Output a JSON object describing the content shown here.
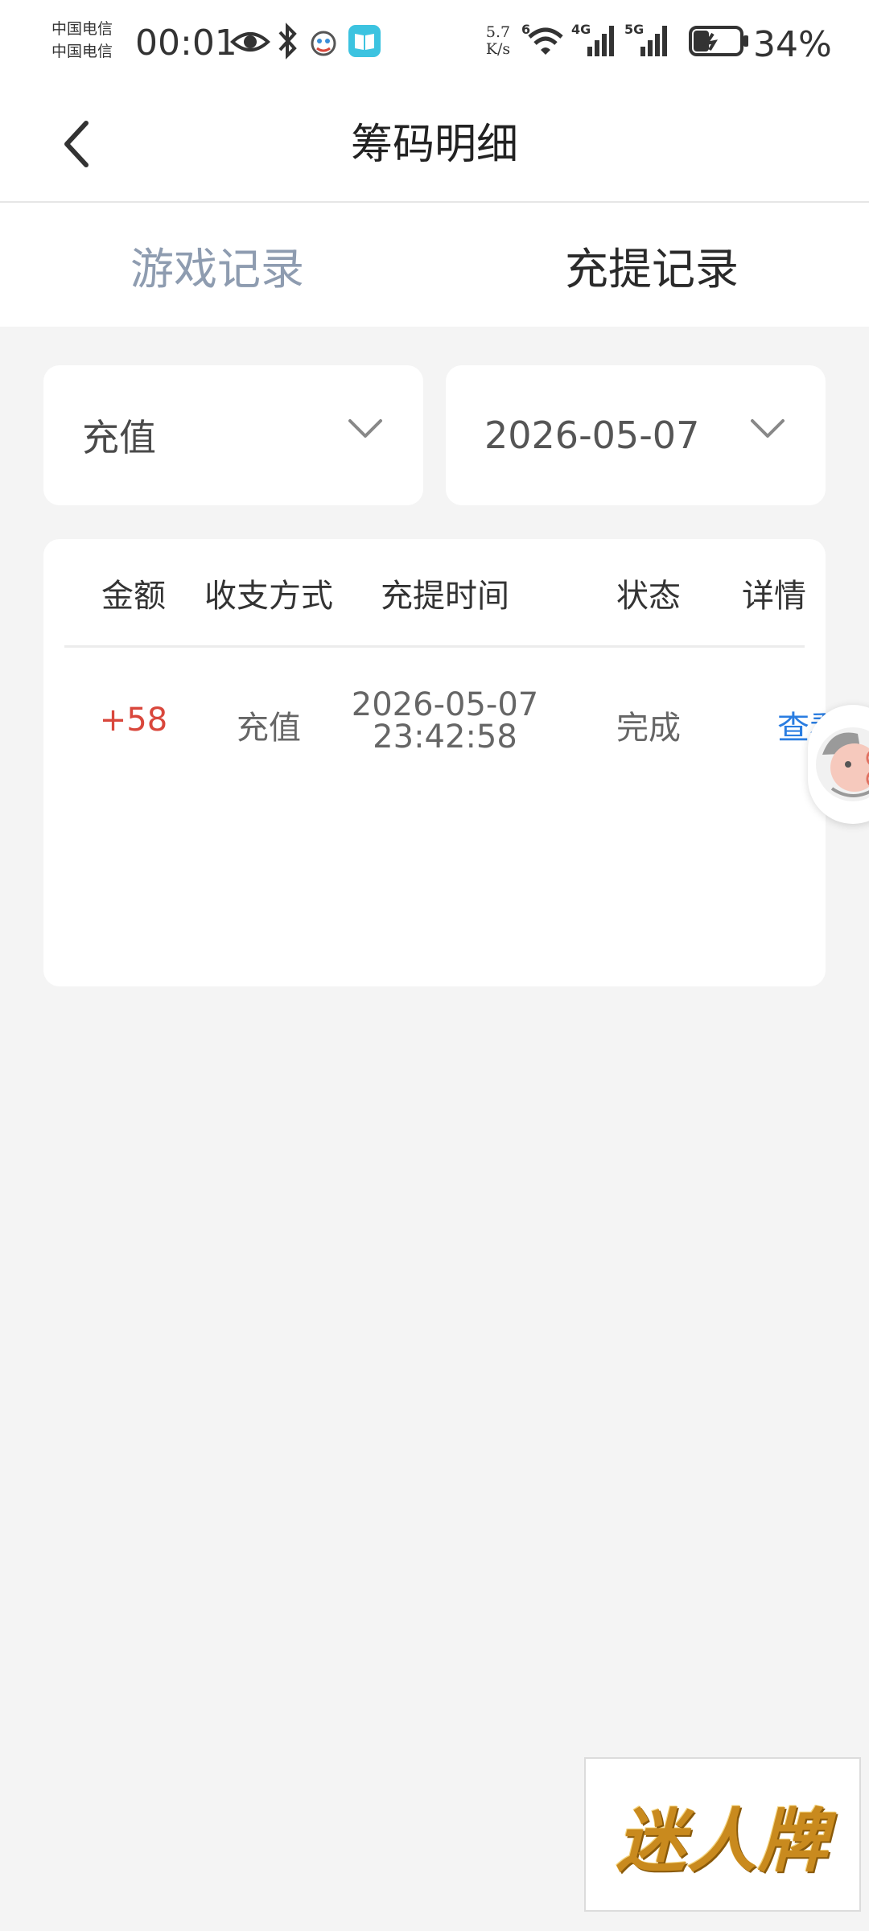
{
  "status_bar": {
    "carrier_line1": "中国电信",
    "carrier_line2": "中国电信",
    "time": "00:01",
    "net_speed_value": "5.7",
    "net_speed_unit": "K/s",
    "signal1_label": "4G",
    "signal2_label": "5G",
    "wifi_label": "6",
    "battery_percent": "34%",
    "battery_level": 0.34
  },
  "nav": {
    "title": "筹码明细"
  },
  "tabs": [
    {
      "label": "游戏记录",
      "active": false
    },
    {
      "label": "充提记录",
      "active": true
    }
  ],
  "filters": {
    "type": "充值",
    "date": "2026-05-07"
  },
  "table": {
    "columns": [
      "金额",
      "收支方式",
      "充提时间",
      "状态",
      "详情"
    ],
    "rows": [
      {
        "amount": "+58",
        "method": "充值",
        "date": "2026-05-07",
        "time": "23:42:58",
        "status": "完成",
        "detail": "查看"
      }
    ]
  },
  "logo": {
    "text": "迷人牌"
  },
  "colors": {
    "amount_positive": "#d9473c",
    "link": "#2a7de1",
    "tab_inactive": "#8e9cb0",
    "logo_gold": "#c98a1e"
  }
}
